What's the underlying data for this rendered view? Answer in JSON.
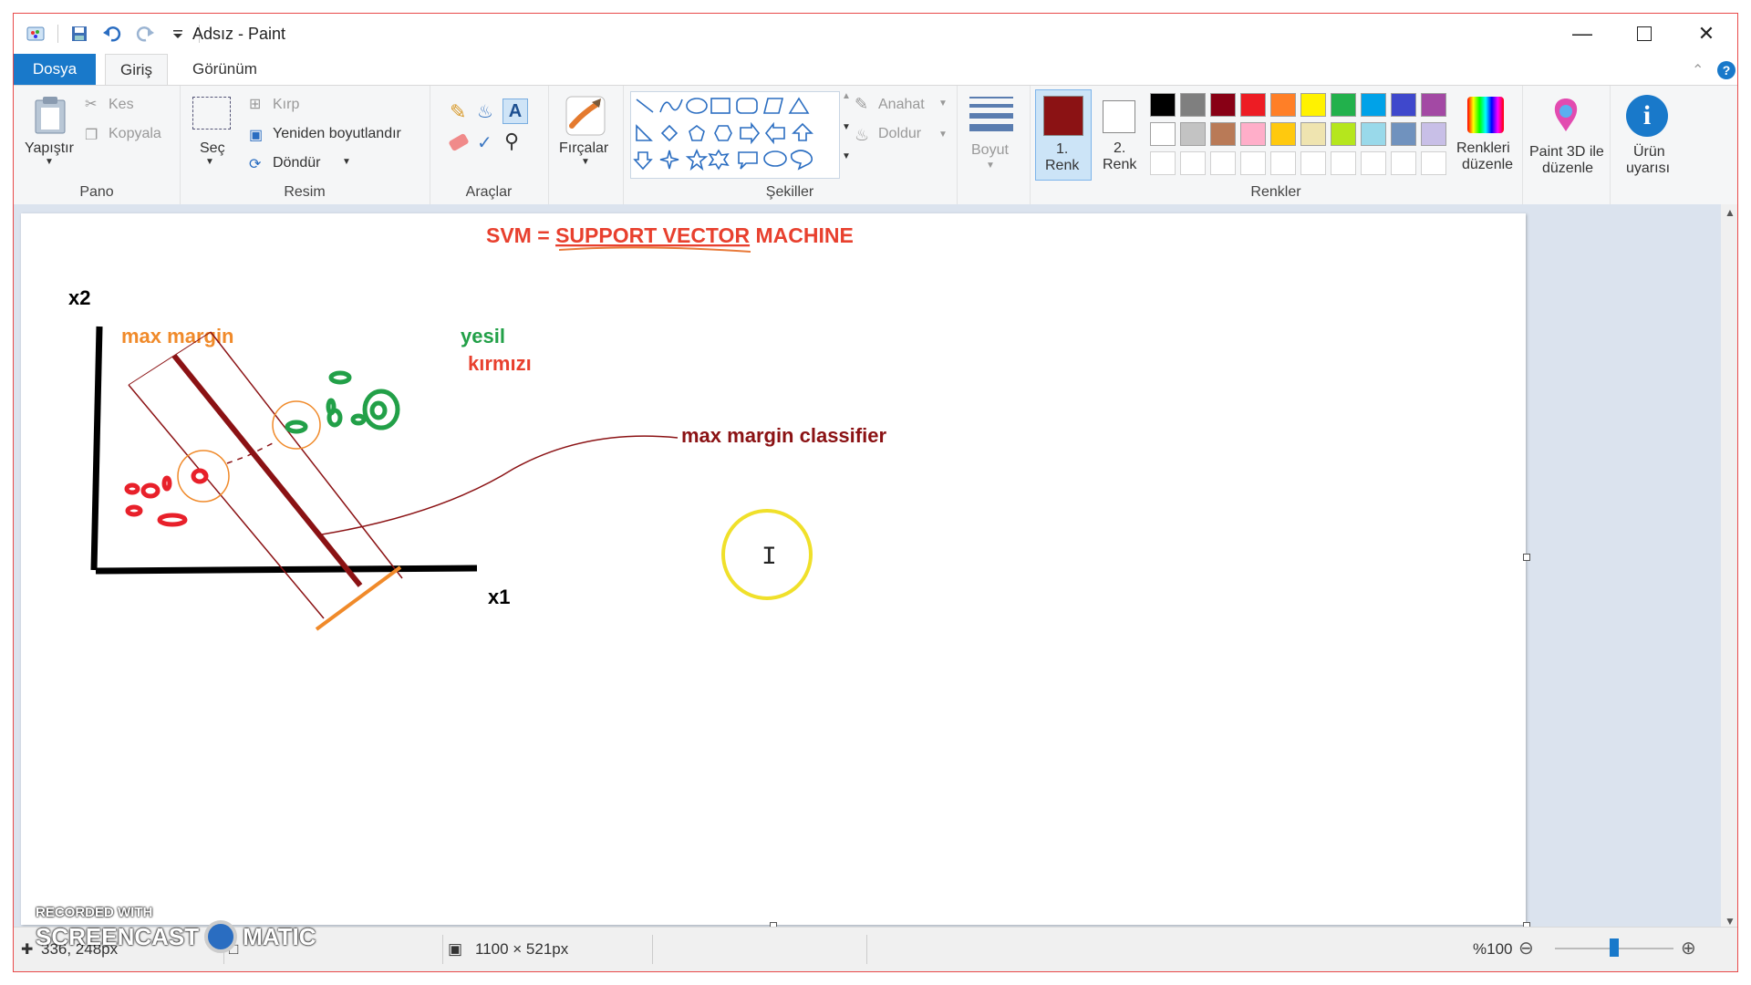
{
  "window": {
    "title": "Adsız - Paint"
  },
  "menu": {
    "file": "Dosya",
    "home": "Giriş",
    "view": "Görünüm"
  },
  "clipboard": {
    "paste": "Yapıştır",
    "cut": "Kes",
    "copy": "Kopyala",
    "label": "Pano"
  },
  "image": {
    "select": "Seç",
    "crop": "Kırp",
    "resize": "Yeniden boyutlandır",
    "rotate": "Döndür",
    "label": "Resim"
  },
  "tools": {
    "label": "Araçlar"
  },
  "brushes": {
    "label": "Fırçalar"
  },
  "shapes": {
    "label": "Şekiller",
    "outline": "Anahat",
    "fill": "Doldur"
  },
  "size": {
    "label": "Boyut"
  },
  "color1": {
    "line1": "1.",
    "line2": "Renk",
    "value": "#8b1214"
  },
  "color2": {
    "line1": "2.",
    "line2": "Renk",
    "value": "#ffffff"
  },
  "colors": {
    "label": "Renkler",
    "palette_row1": [
      "#000000",
      "#7f7f7f",
      "#880015",
      "#ed1c24",
      "#ff7f27",
      "#fff200",
      "#22b14c",
      "#00a2e8",
      "#3f48cc",
      "#a349a4"
    ],
    "palette_row2": [
      "#ffffff",
      "#c3c3c3",
      "#b97a57",
      "#ffaec9",
      "#ffc90e",
      "#efe4b0",
      "#b5e61d",
      "#99d9ea",
      "#7092be",
      "#c8bfe7"
    ]
  },
  "edit_colors": {
    "line1": "Renkleri",
    "line2": "düzenle"
  },
  "paint3d": {
    "line1": "Paint 3D ile",
    "line2": "düzenle"
  },
  "product_alert": {
    "line1": "Ürün",
    "line2": "uyarısı"
  },
  "drawing": {
    "title_prefix": "SVM = ",
    "title_mid": "SUPPORT VECTOR",
    "title_suffix": " MACHINE",
    "axis_y": "x2",
    "axis_x": "x1",
    "label_max_margin": "max margin",
    "label_green": "yesil",
    "label_red": "kırmızı",
    "label_classifier": "max margin classifier"
  },
  "status": {
    "cursor_pos": "336, 248px",
    "canvas_size": "1100 × 521px",
    "zoom": "%100"
  },
  "watermark": {
    "line1": "RECORDED WITH",
    "line2": "SCREENCAST",
    "line3": "MATIC"
  }
}
